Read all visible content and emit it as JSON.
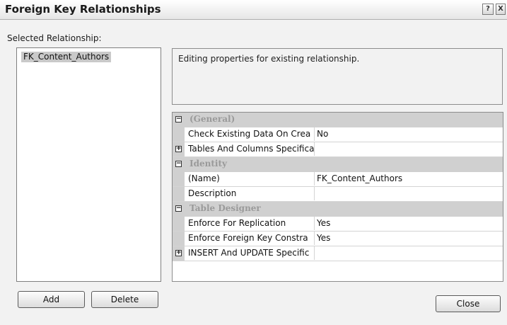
{
  "window": {
    "title": "Foreign Key Relationships",
    "help_glyph": "?",
    "close_glyph": "X"
  },
  "selected_relationship_label": "Selected Relationship:",
  "relationships": [
    "FK_Content_Authors"
  ],
  "info_text": "Editing properties for existing relationship.",
  "properties": [
    {
      "type": "category",
      "label": "(General)",
      "expander": "−"
    },
    {
      "type": "prop",
      "name": "Check Existing Data On Crea",
      "value": "No"
    },
    {
      "type": "prop",
      "name": "Tables And Columns Specifica",
      "value": "",
      "expander": "+"
    },
    {
      "type": "category",
      "label": "Identity",
      "expander": "−"
    },
    {
      "type": "prop",
      "name": "(Name)",
      "value": "FK_Content_Authors"
    },
    {
      "type": "prop",
      "name": "Description",
      "value": ""
    },
    {
      "type": "category",
      "label": "Table Designer",
      "expander": "−"
    },
    {
      "type": "prop",
      "name": "Enforce For Replication",
      "value": "Yes"
    },
    {
      "type": "prop",
      "name": "Enforce Foreign Key Constra",
      "value": "Yes"
    },
    {
      "type": "prop",
      "name": "INSERT And UPDATE Specific",
      "value": "",
      "expander": "+"
    }
  ],
  "buttons": {
    "add": "Add",
    "delete": "Delete",
    "close": "Close"
  }
}
